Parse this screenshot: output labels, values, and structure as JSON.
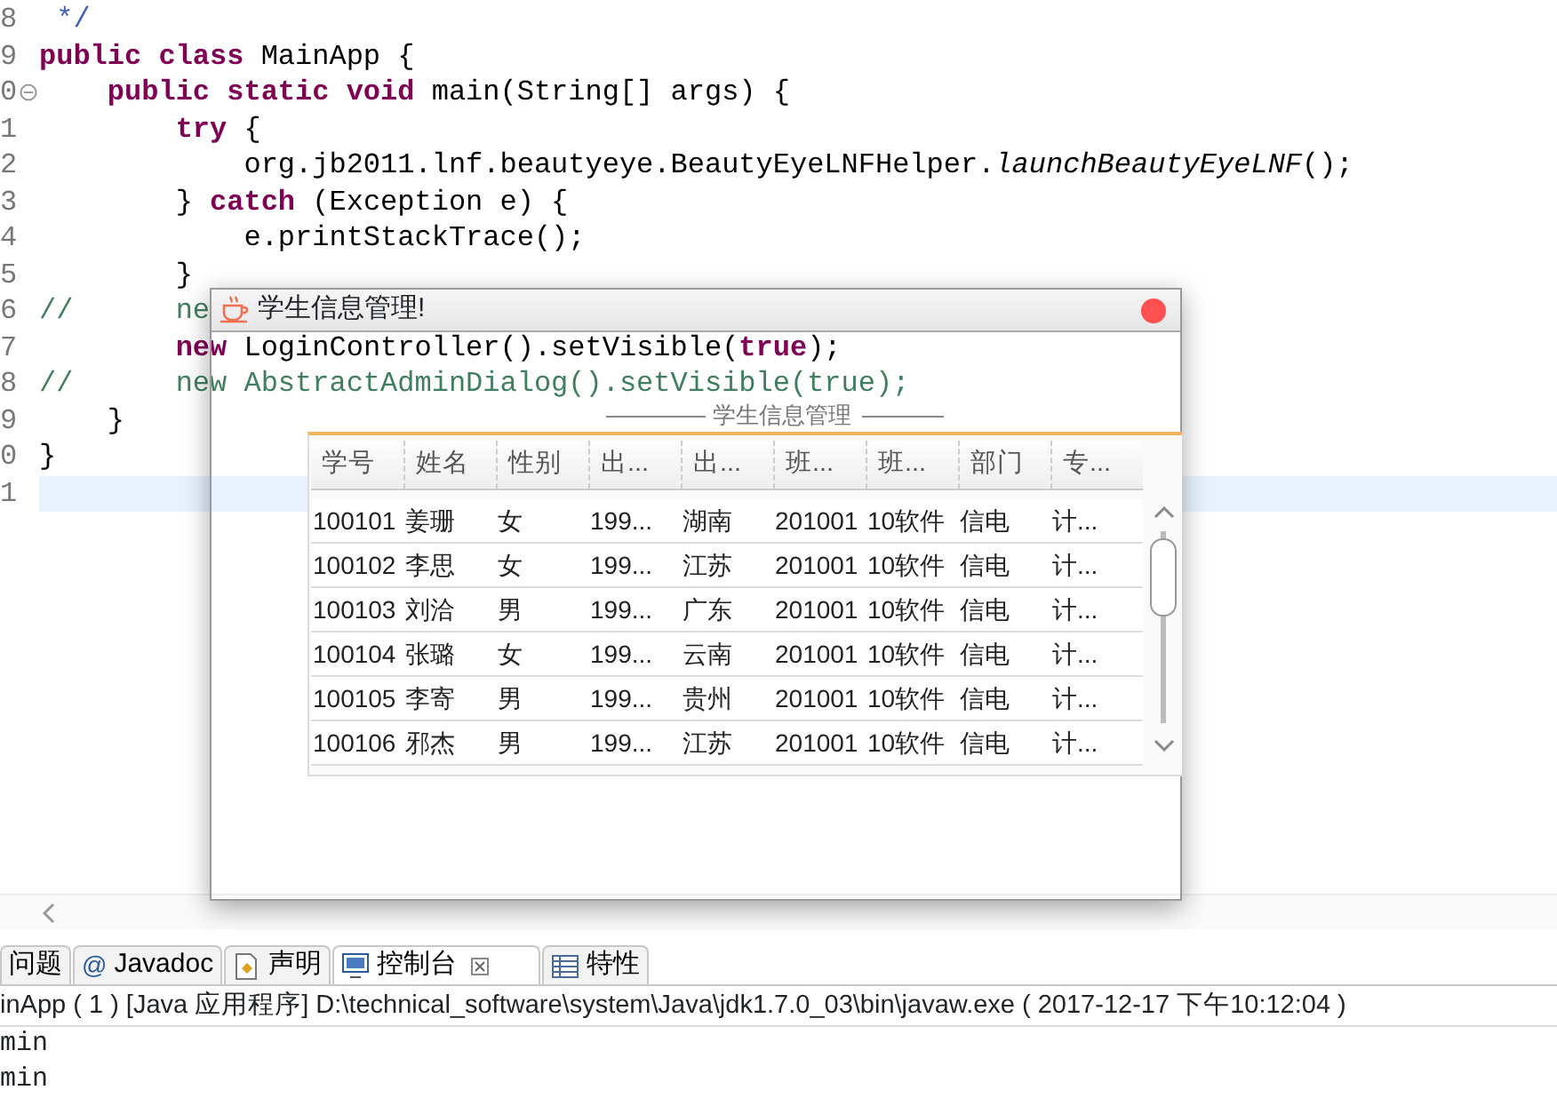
{
  "editor": {
    "lines": [
      {
        "number": "8",
        "selected": false,
        "fold": false,
        "tokens": [
          {
            "kind": "doc",
            "text": " */"
          }
        ]
      },
      {
        "number": "9",
        "selected": false,
        "fold": false,
        "tokens": [
          {
            "kind": "keyword",
            "text": "public class"
          },
          {
            "kind": "plain",
            "text": " MainApp {"
          }
        ]
      },
      {
        "number": "0",
        "selected": false,
        "fold": true,
        "tokens": [
          {
            "kind": "keyword",
            "text": "    public static void"
          },
          {
            "kind": "plain",
            "text": " main(String[] args) {"
          }
        ]
      },
      {
        "number": "1",
        "selected": false,
        "fold": false,
        "tokens": [
          {
            "kind": "keyword",
            "text": "        try"
          },
          {
            "kind": "plain",
            "text": " {"
          }
        ]
      },
      {
        "number": "2",
        "selected": false,
        "fold": false,
        "tokens": [
          {
            "kind": "plain",
            "text": "            org.jb2011.lnf.beautyeye.BeautyEyeLNFHelper."
          },
          {
            "kind": "italic",
            "text": "launchBeautyEyeLNF"
          },
          {
            "kind": "plain",
            "text": "();"
          }
        ]
      },
      {
        "number": "3",
        "selected": false,
        "fold": false,
        "tokens": [
          {
            "kind": "plain",
            "text": "        } "
          },
          {
            "kind": "keyword",
            "text": "catch"
          },
          {
            "kind": "plain",
            "text": " (Exception e) {"
          }
        ]
      },
      {
        "number": "4",
        "selected": false,
        "fold": false,
        "tokens": [
          {
            "kind": "plain",
            "text": "            e.printStackTrace();"
          }
        ]
      },
      {
        "number": "5",
        "selected": false,
        "fold": false,
        "tokens": [
          {
            "kind": "plain",
            "text": "        }"
          }
        ]
      },
      {
        "number": "6",
        "selected": false,
        "fold": false,
        "tokens": [
          {
            "kind": "comment",
            "text": "//      ne"
          }
        ]
      },
      {
        "number": "7",
        "selected": false,
        "fold": false,
        "tokens": [
          {
            "kind": "keyword",
            "text": "        new"
          },
          {
            "kind": "plain",
            "text": " LoginController().setVisible("
          },
          {
            "kind": "keyword",
            "text": "true"
          },
          {
            "kind": "plain",
            "text": ");"
          }
        ]
      },
      {
        "number": "8",
        "selected": false,
        "fold": false,
        "tokens": [
          {
            "kind": "comment",
            "text": "//      new AbstractAdminDialog().setVisible(true);"
          }
        ]
      },
      {
        "number": "9",
        "selected": false,
        "fold": false,
        "tokens": [
          {
            "kind": "plain",
            "text": "    }"
          }
        ]
      },
      {
        "number": "0",
        "selected": false,
        "fold": false,
        "tokens": [
          {
            "kind": "plain",
            "text": "}"
          }
        ]
      },
      {
        "number": "1",
        "selected": true,
        "fold": false
      }
    ]
  },
  "dialog": {
    "title": "学生信息管理!",
    "group_title": "学生信息管理",
    "table": {
      "columns": [
        "学号",
        "姓名",
        "性别",
        "出...",
        "出...",
        "班...",
        "班...",
        "部门",
        "专..."
      ],
      "rows": [
        [
          "100101",
          "姜珊",
          "女",
          "199...",
          "湖南",
          "201001",
          "10软件",
          "信电",
          "计..."
        ],
        [
          "100102",
          "李思",
          "女",
          "199...",
          "江苏",
          "201001",
          "10软件",
          "信电",
          "计..."
        ],
        [
          "100103",
          "刘洽",
          "男",
          "199...",
          "广东",
          "201001",
          "10软件",
          "信电",
          "计..."
        ],
        [
          "100104",
          "张璐",
          "女",
          "199...",
          "云南",
          "201001",
          "10软件",
          "信电",
          "计..."
        ],
        [
          "100105",
          "李寄",
          "男",
          "199...",
          "贵州",
          "201001",
          "10软件",
          "信电",
          "计..."
        ],
        [
          "100106",
          "邪杰",
          "男",
          "199...",
          "江苏",
          "201001",
          "10软件",
          "信电",
          "计..."
        ]
      ]
    }
  },
  "console": {
    "tabs": [
      {
        "label": "问题",
        "selected": false,
        "closable": false
      },
      {
        "symbol": "@",
        "label": "Javadoc",
        "selected": false,
        "closable": false
      },
      {
        "label": "声明",
        "selected": false,
        "closable": false
      },
      {
        "label": "控制台",
        "selected": true,
        "closable": true
      },
      {
        "label": "特性",
        "selected": false,
        "closable": false
      }
    ],
    "header": "inApp ( 1 )  [Java 应用程序] D:\\technical_software\\system\\Java\\jdk1.7.0_03\\bin\\javaw.exe ( 2017-12-17 下午10:12:04 )",
    "output": [
      "min",
      "min"
    ]
  }
}
